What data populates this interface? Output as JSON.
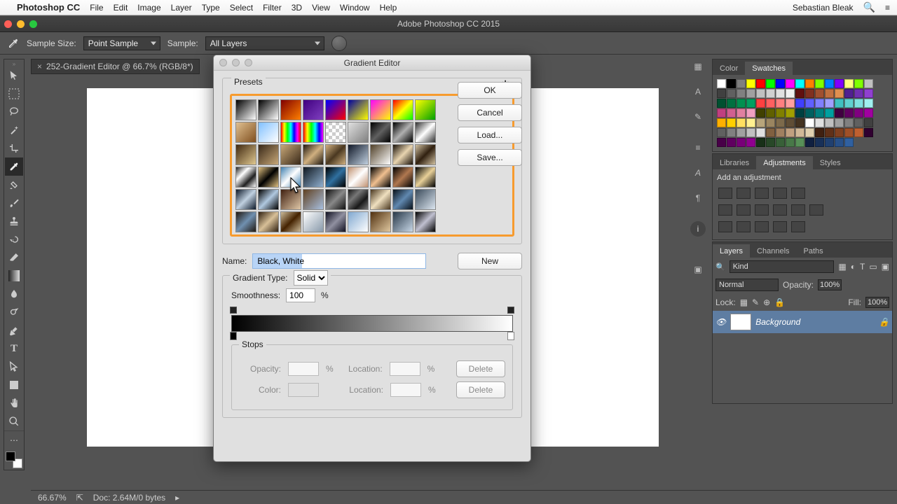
{
  "menubar": {
    "apple": "",
    "app": "Photoshop CC",
    "items": [
      "File",
      "Edit",
      "Image",
      "Layer",
      "Type",
      "Select",
      "Filter",
      "3D",
      "View",
      "Window",
      "Help"
    ],
    "user": "Sebastian Bleak"
  },
  "doc_titlebar": "Adobe Photoshop CC 2015",
  "options": {
    "sample_size_label": "Sample Size:",
    "sample_size_value": "Point Sample",
    "sample_label": "Sample:",
    "sample_value": "All Layers"
  },
  "doc_tab": {
    "name": "252-Gradient Editor @ 66.7% (RGB/8*)",
    "close": "×"
  },
  "footer": {
    "zoom": "66.67%",
    "docinfo": "Doc: 2.64M/0 bytes"
  },
  "dialog": {
    "title": "Gradient Editor",
    "presets_label": "Presets",
    "name_label": "Name:",
    "name_value": "Black, White",
    "grad_type_label": "Gradient Type:",
    "grad_type_value": "Solid",
    "smooth_label": "Smoothness:",
    "smooth_value": "100",
    "pct": "%",
    "stops_label": "Stops",
    "opacity_label": "Opacity:",
    "location_label": "Location:",
    "color_label": "Color:",
    "ok": "OK",
    "cancel": "Cancel",
    "load": "Load...",
    "save": "Save...",
    "new": "New",
    "delete": "Delete"
  },
  "panels": {
    "color": "Color",
    "swatches": "Swatches",
    "libraries": "Libraries",
    "adjustments": "Adjustments",
    "styles": "Styles",
    "add_adj": "Add an adjustment",
    "layers": "Layers",
    "channels": "Channels",
    "paths": "Paths",
    "kind": "Kind",
    "blend": "Normal",
    "opacity_l": "Opacity:",
    "opacity_v": "100%",
    "lock": "Lock:",
    "fill_l": "Fill:",
    "fill_v": "100%",
    "bg_layer": "Background"
  },
  "swatch_colors": [
    "#ffffff",
    "#000000",
    "#7f7f7f",
    "#ffff00",
    "#ff0000",
    "#00ff00",
    "#0000ff",
    "#ff00ff",
    "#00ffff",
    "#ff8000",
    "#80ff00",
    "#0080ff",
    "#8000ff",
    "#ffff80",
    "#80ff00",
    "#c0c0c0",
    "#404040",
    "#606060",
    "#808080",
    "#a0a0a0",
    "#c0c0c0",
    "#d0d0d0",
    "#e0e0e0",
    "#f0f0f0",
    "#601010",
    "#803020",
    "#a05030",
    "#c07040",
    "#e09050",
    "#502090",
    "#7030b0",
    "#9040d0",
    "#005030",
    "#007040",
    "#009050",
    "#00a060",
    "#ff4040",
    "#ff6060",
    "#ff8080",
    "#ffa0a0",
    "#4040ff",
    "#6060ff",
    "#8080ff",
    "#a0a0ff",
    "#40c0c0",
    "#60d0d0",
    "#80e0e0",
    "#a0f0f0",
    "#c04080",
    "#d06090",
    "#e080a0",
    "#f0a0c0",
    "#404000",
    "#606000",
    "#808000",
    "#a0a000",
    "#004040",
    "#006060",
    "#008080",
    "#00a0a0",
    "#400040",
    "#600060",
    "#800080",
    "#a000a0",
    "#ffb000",
    "#ffd000",
    "#ffe060",
    "#fff090",
    "#b8a57b",
    "#9a8560",
    "#7d6a4b",
    "#604e36",
    "#443321",
    "#ffffff",
    "#e0e0e0",
    "#c0c0c0",
    "#a0a0a0",
    "#808080",
    "#606060",
    "#404040",
    "#606060",
    "#808080",
    "#a0a0a0",
    "#c0c0c0",
    "#e0e0e0",
    "#806040",
    "#a08060",
    "#c0a080",
    "#d0b898",
    "#e0d0b0",
    "#402010",
    "#603018",
    "#804020",
    "#a05028",
    "#c06030",
    "#300030",
    "#480048",
    "#600060",
    "#780078",
    "#900090",
    "#183018",
    "#284828",
    "#386038",
    "#487848",
    "#589058",
    "#102040",
    "#183058",
    "#204070",
    "#285088",
    "#3060a0"
  ],
  "presets": [
    "linear-gradient(135deg,#000,#fff)",
    "linear-gradient(135deg,#000,#fff)",
    "linear-gradient(135deg,#800000,#ff8000)",
    "linear-gradient(135deg,#400080,#8040c0)",
    "linear-gradient(135deg,#0000ff,#ff0000)",
    "linear-gradient(135deg,#0000a0,#ffff00)",
    "linear-gradient(135deg,#ff00ff,#ffff00)",
    "linear-gradient(135deg,#ff0000,#ffff00,#00ff00)",
    "linear-gradient(135deg,#ffff00,#00a000)",
    "linear-gradient(135deg,#e0c090,#805020)",
    "linear-gradient(135deg,#80c0ff,#ffffff)",
    "linear-gradient(90deg,#ff0000,#ffff00,#00ff00,#00ffff,#0000ff,#ff00ff,#ff0000)",
    "linear-gradient(90deg,#ff0000,#ffff00,#00ff00,#00ffff,#0000ff,#ff00ff)",
    "repeating-conic-gradient(#ccc 0 25%,#fff 0 50%) 50% / 10px 10px",
    "linear-gradient(135deg,rgba(0,0,0,0),#808080)",
    "linear-gradient(135deg,#000,#606060,#000)",
    "linear-gradient(135deg,#000,#b0b0b0,#000)",
    "linear-gradient(135deg,#303030,#fff,#303030)",
    "linear-gradient(135deg,#402810,#e0c890)",
    "linear-gradient(135deg,#382818,#c8a878)",
    "linear-gradient(135deg,#c8a878,#382818)",
    "linear-gradient(135deg,#201810,#d0b080,#201810)",
    "linear-gradient(135deg,#d0b080,#4a3820,#d0b080)",
    "linear-gradient(135deg,#101828,#c0d0e0)",
    "linear-gradient(135deg,#504028,#fff)",
    "linear-gradient(135deg,#181008,#e8d4b0,#181008)",
    "linear-gradient(135deg,#d0c0a0,#302010,#d0c0a0)",
    "linear-gradient(135deg,#202020,#fff,#202020,#fff)",
    "linear-gradient(135deg,#e0c080,#000,#e0c080)",
    "linear-gradient(135deg,#4080b0,#fff,#4080b0)",
    "linear-gradient(135deg,#101820,#90b0d0)",
    "linear-gradient(135deg,#000,#3070a0,#000)",
    "linear-gradient(135deg,#c09070,#fff,#c09070)",
    "linear-gradient(135deg,#000,#f0c090,#000)",
    "linear-gradient(135deg,#000,#b07850,#000)",
    "linear-gradient(135deg,#000,#e8d098,#000)",
    "linear-gradient(135deg,#0c1828,#c0d0e0,#0c1828)",
    "linear-gradient(135deg,#000,#b0c8e0,#000)",
    "linear-gradient(135deg,#402010,#e0c8a8)",
    "linear-gradient(135deg,#604020,#a8c0e0)",
    "linear-gradient(135deg,#101010,#888,#101010)",
    "linear-gradient(135deg,#181818,#777,#181818,#777)",
    "linear-gradient(135deg,#4a3820,#f0e0c0,#4a3820)",
    "linear-gradient(135deg,#081018,#6088b0,#081018)",
    "linear-gradient(135deg,#3b4b5b,#dce6f0)",
    "linear-gradient(135deg,#201810,#7090b0,#201810)",
    "linear-gradient(135deg,#302010,#d8c098,#302010)",
    "linear-gradient(135deg,#ccbb99,#442200,#ccbb99)",
    "linear-gradient(135deg,#ffffff,#8899aa)",
    "linear-gradient(135deg,#101020,#9090a0,#101020)",
    "linear-gradient(135deg,#80a8d0,#fff)",
    "linear-gradient(135deg,#503010,#e0c8a0)",
    "linear-gradient(135deg,#283848,#c8d8e8)",
    "linear-gradient(135deg,#000,#c0c0d0,#000)",
    "linear-gradient(135deg,#9898a8,#fff)",
    "linear-gradient(135deg,#d0b898,#302010,#d0b898)",
    "linear-gradient(135deg,#101010,#787878,#101010,#787878)"
  ]
}
